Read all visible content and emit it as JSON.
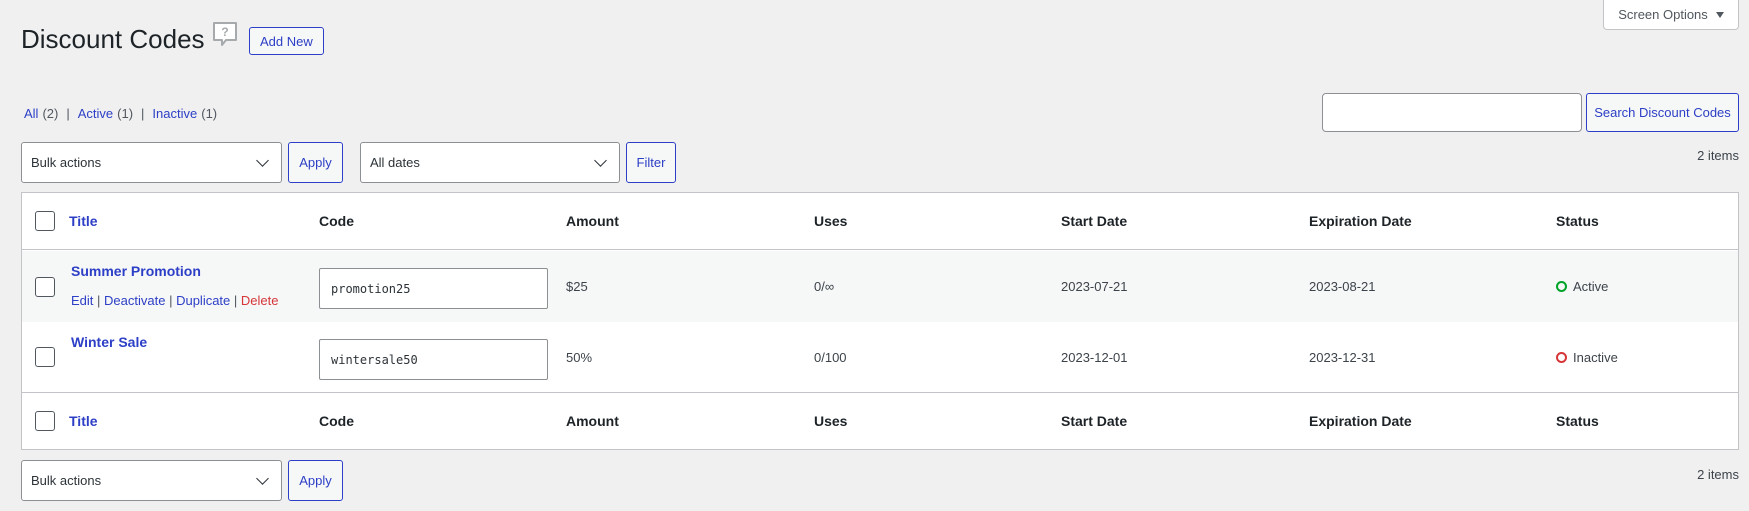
{
  "screen_options": {
    "label": "Screen Options"
  },
  "header": {
    "title": "Discount Codes",
    "add_new": "Add New"
  },
  "filters": {
    "all": {
      "label": "All",
      "count": "(2)"
    },
    "active": {
      "label": "Active",
      "count": "(1)"
    },
    "inactive": {
      "label": "Inactive",
      "count": "(1)"
    }
  },
  "search": {
    "value": "",
    "button": "Search Discount Codes"
  },
  "tablenav_top": {
    "bulk_actions": "Bulk actions",
    "apply": "Apply",
    "dates": "All dates",
    "filter": "Filter",
    "items": "2 items"
  },
  "tablenav_bottom": {
    "bulk_actions": "Bulk actions",
    "apply": "Apply",
    "items": "2 items"
  },
  "columns": {
    "title": "Title",
    "code": "Code",
    "amount": "Amount",
    "uses": "Uses",
    "start": "Start Date",
    "expiration": "Expiration Date",
    "status": "Status"
  },
  "rows": [
    {
      "title": "Summer Promotion",
      "code": "promotion25",
      "amount": "$25",
      "uses": "0/∞",
      "start": "2023-07-21",
      "expiration": "2023-08-21",
      "status": "Active",
      "status_color": "#00a32a",
      "actions": {
        "edit": "Edit",
        "deactivate": "Deactivate",
        "duplicate": "Duplicate",
        "delete": "Delete"
      }
    },
    {
      "title": "Winter Sale",
      "code": "wintersale50",
      "amount": "50%",
      "uses": "0/100",
      "start": "2023-12-01",
      "expiration": "2023-12-31",
      "status": "Inactive",
      "status_color": "#d63638"
    }
  ],
  "colors": {
    "accent": "#2c3fc6",
    "active": "#00a32a",
    "inactive": "#d63638",
    "delete": "#d63638"
  }
}
